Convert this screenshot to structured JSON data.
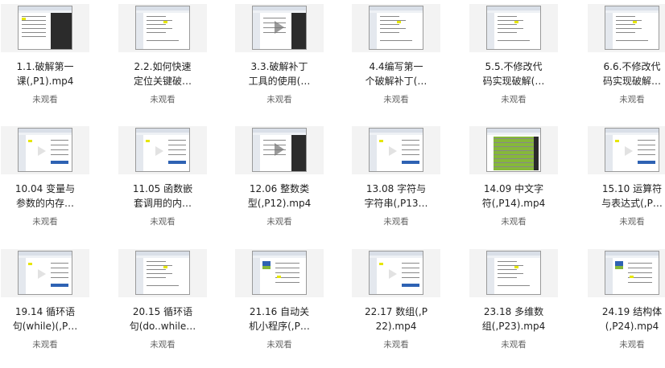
{
  "items": [
    {
      "title": "1.1.破解第一\n课(,P1).mp4",
      "status": "未观看",
      "thumb": "dark"
    },
    {
      "title": "2.2.如何快速\n定位关键破…",
      "status": "未观看",
      "thumb": "doc"
    },
    {
      "title": "3.3.破解补丁\n工具的使用(…",
      "status": "未观看",
      "thumb": "video"
    },
    {
      "title": "4.4编写第一\n个破解补丁(…",
      "status": "未观看",
      "thumb": "doc"
    },
    {
      "title": "5.5.不修改代\n码实现破解(…",
      "status": "未观看",
      "thumb": "doc"
    },
    {
      "title": "6.6.不修改代\n码实现破解…",
      "status": "未观看",
      "thumb": "doc"
    },
    {
      "title": "10.04 变量与\n参数的内存…",
      "status": "未观看",
      "thumb": "ide"
    },
    {
      "title": "11.05 函数嵌\n套调用的内…",
      "status": "未观看",
      "thumb": "ide"
    },
    {
      "title": "12.06 整数类\n型(,P12).mp4",
      "status": "未观看",
      "thumb": "video"
    },
    {
      "title": "13.08 字符与\n字符串(,P13…",
      "status": "未观看",
      "thumb": "ide"
    },
    {
      "title": "14.09 中文字\n符(,P14).mp4",
      "status": "未观看",
      "thumb": "table"
    },
    {
      "title": "15.10 运算符\n与表达式(,P…",
      "status": "未观看",
      "thumb": "ide"
    },
    {
      "title": "19.14 循环语\n句(while)(,P…",
      "status": "未观看",
      "thumb": "ide"
    },
    {
      "title": "20.15 循环语\n句(do..while…",
      "status": "未观看",
      "thumb": "doc"
    },
    {
      "title": "21.16 自动关\n机小程序(,P…",
      "status": "未观看",
      "thumb": "logo"
    },
    {
      "title": "22.17 数组(,P\n22).mp4",
      "status": "未观看",
      "thumb": "ide"
    },
    {
      "title": "23.18 多维数\n组(,P23).mp4",
      "status": "未观看",
      "thumb": "doc"
    },
    {
      "title": "24.19 结构体\n(,P24).mp4",
      "status": "未观看",
      "thumb": "logo"
    }
  ],
  "colors": {
    "text": "#222222",
    "status": "#666666",
    "thumb_bg": "#f3f3f3"
  },
  "icons": {
    "play": "play-triangle-icon"
  }
}
